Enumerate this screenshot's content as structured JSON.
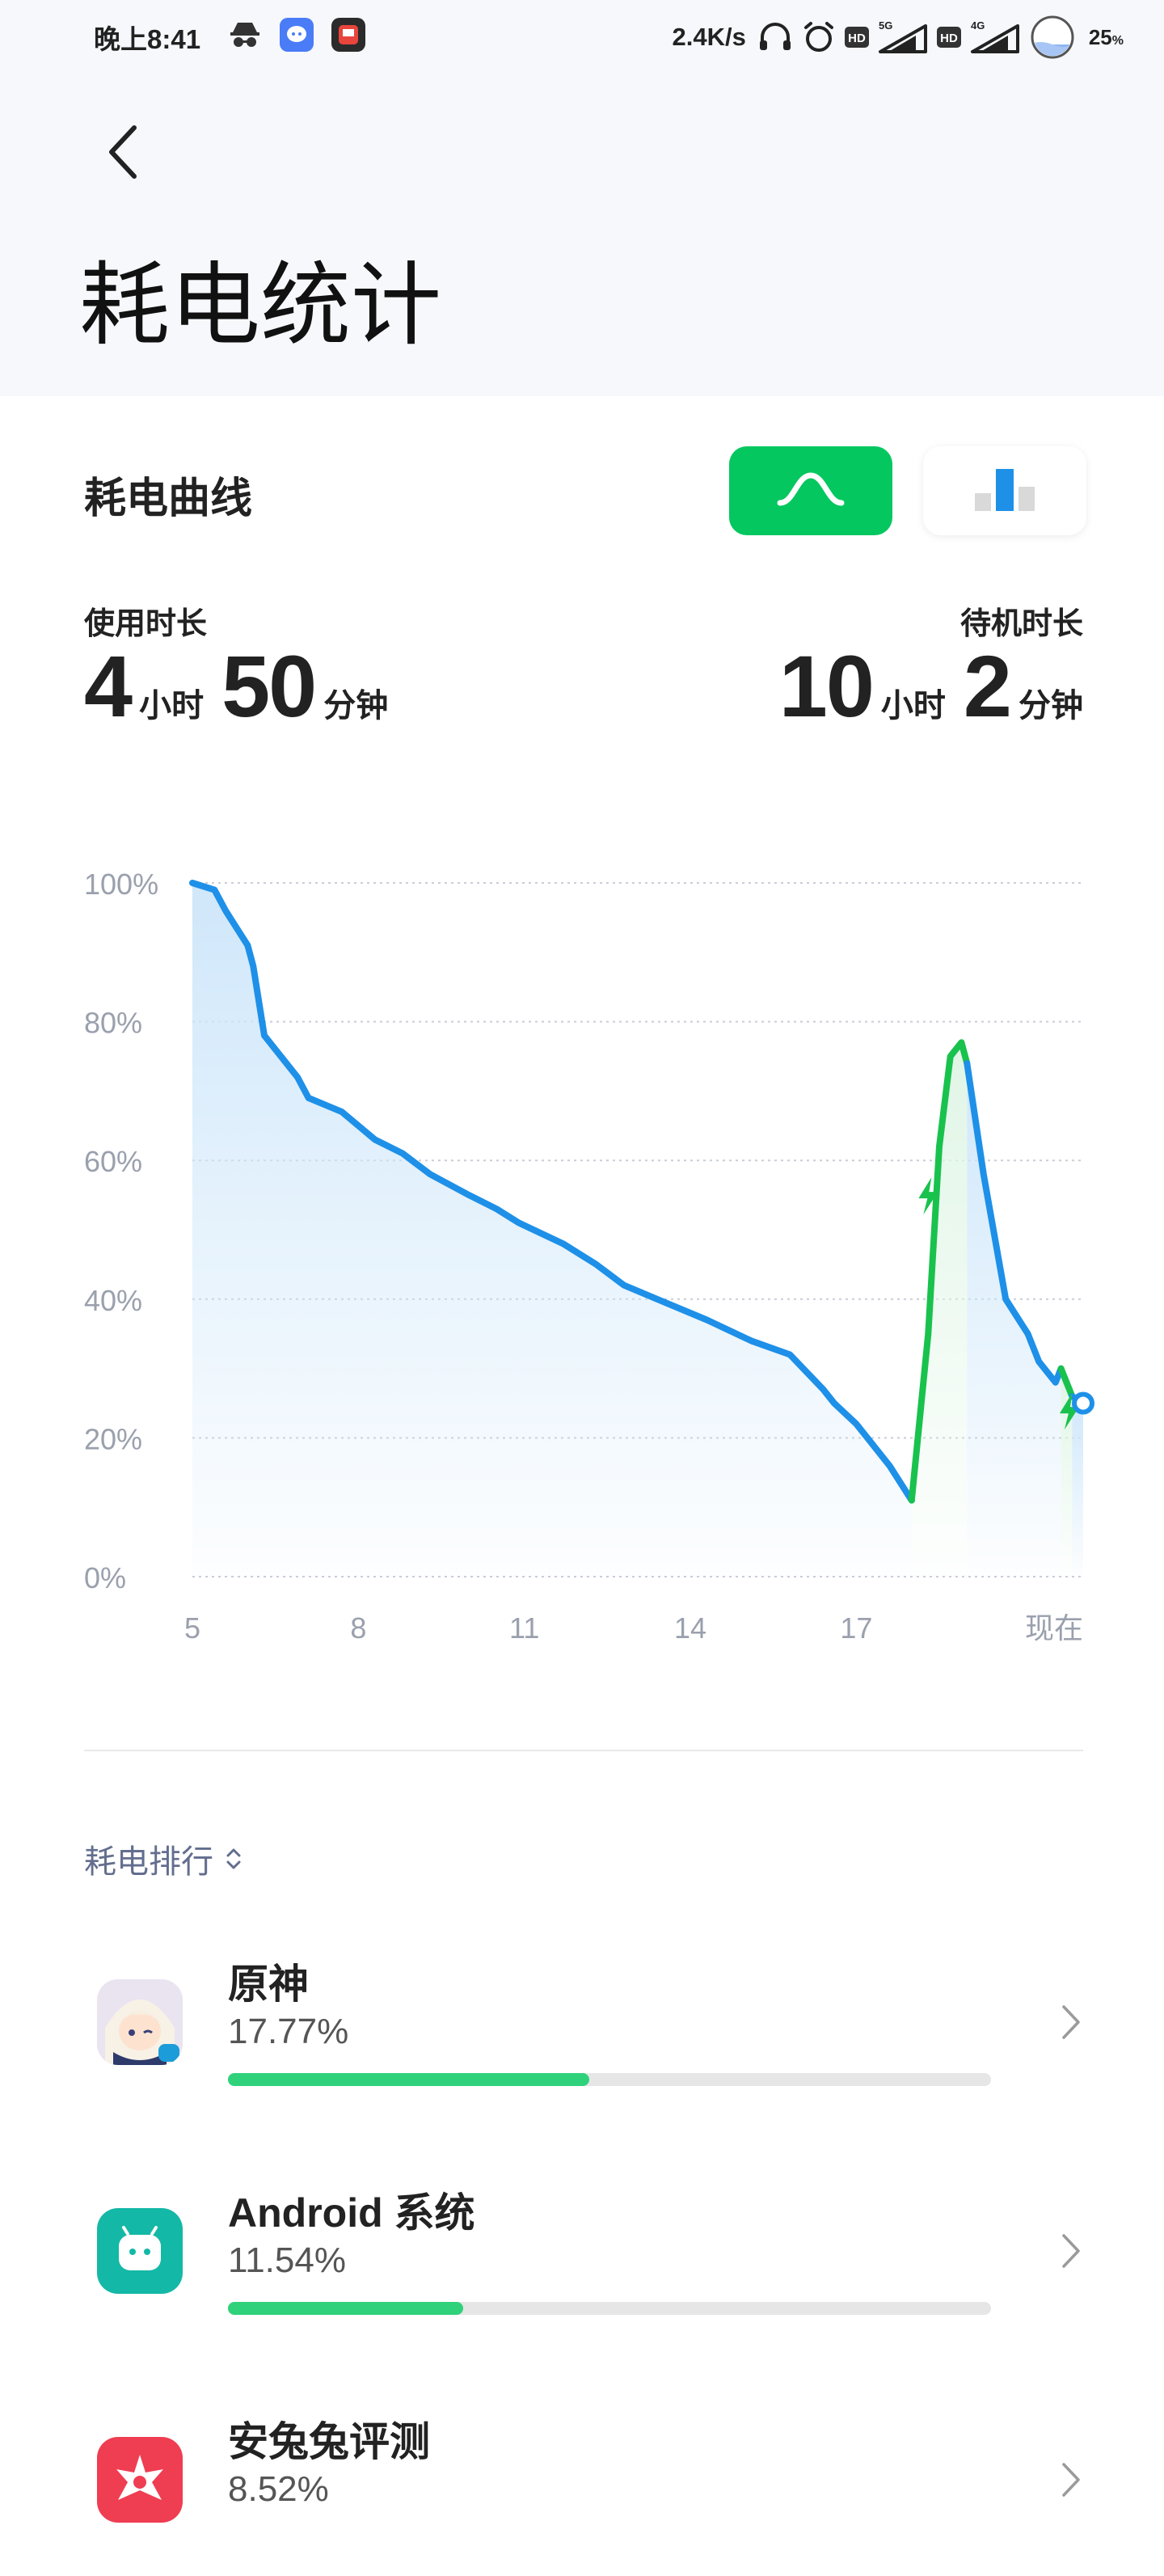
{
  "status_bar": {
    "time": "晚上8:41",
    "net_speed": "2.4K/s",
    "sim1_type": "5G",
    "sim2_type": "4G",
    "hd_label": "HD",
    "battery_level": "25",
    "battery_suffix": "%",
    "icons": [
      "incognito-icon",
      "message-app-icon",
      "music-app-icon",
      "headphones-icon",
      "alarm-icon",
      "hd-icon",
      "signal-icon",
      "battery-icon"
    ]
  },
  "header": {
    "title": "耗电统计"
  },
  "curve_section": {
    "title": "耗电曲线",
    "toggle_curve": "curve-view-icon",
    "toggle_bar": "bar-view-icon",
    "active_view": "curve"
  },
  "usage": {
    "label": "使用时长",
    "hours": "4",
    "hours_unit": "小时",
    "minutes": "50",
    "minutes_unit": "分钟"
  },
  "standby": {
    "label": "待机时长",
    "hours": "10",
    "hours_unit": "小时",
    "minutes": "2",
    "minutes_unit": "分钟"
  },
  "chart_data": {
    "type": "line",
    "y_tick_labels": [
      "100%",
      "80%",
      "60%",
      "40%",
      "20%",
      "0%"
    ],
    "ylim": [
      0,
      100
    ],
    "x_tick_labels": [
      "5",
      "8",
      "11",
      "14",
      "17",
      "现在"
    ],
    "x_tick_values": [
      5,
      8,
      11,
      14,
      17,
      21.1
    ],
    "xlim": [
      5,
      21.1
    ],
    "grid": true,
    "colors": {
      "discharge": "#1e90e8",
      "charge": "#19c24d",
      "fill": "#cde6fa",
      "charge_fill": "#dff5e5",
      "grid": "#c9cdd6"
    },
    "series": [
      {
        "x": [
          5.0,
          5.4,
          5.6,
          6.0,
          6.1,
          6.3,
          6.6,
          6.9,
          7.1,
          7.7,
          8.3,
          8.8,
          9.3,
          10.0,
          10.5,
          10.9,
          11.7,
          12.3,
          12.8,
          13.4,
          14.3,
          15.1,
          15.8,
          16.4,
          16.6,
          17.0,
          17.6,
          18.0
        ],
        "y": [
          100,
          99,
          96,
          91,
          88,
          78,
          75,
          72,
          69,
          67,
          63,
          61,
          58,
          55,
          53,
          51,
          48,
          45,
          42,
          40,
          37,
          34,
          32,
          27,
          25,
          22,
          16,
          11
        ]
      },
      {
        "x": [
          18.0,
          18.3,
          18.5,
          18.7,
          18.9,
          19.0
        ],
        "y": [
          11,
          35,
          62,
          75,
          77,
          74
        ]
      },
      {
        "x": [
          19.0,
          19.3,
          19.7,
          20.1,
          20.3,
          20.6,
          20.7
        ],
        "y": [
          74,
          58,
          40,
          35,
          31,
          28,
          30
        ]
      },
      {
        "x": [
          20.7,
          20.9
        ],
        "y": [
          30,
          26
        ]
      },
      {
        "x": [
          20.9,
          21.1
        ],
        "y": [
          26,
          25
        ]
      }
    ],
    "series_kind": [
      "discharge",
      "charge",
      "discharge",
      "charge",
      "discharge"
    ],
    "charge_markers": [
      {
        "x": 18.3,
        "y": 55
      },
      {
        "x": 20.85,
        "y": 24
      }
    ],
    "current_point": {
      "x": 21.1,
      "y": 25
    }
  },
  "ranking": {
    "sort_label": "耗电排行",
    "sort_icon": "sort-updown-icon",
    "apps": [
      {
        "name": "原神",
        "percent_label": "17.77%",
        "fraction": 0.1777,
        "icon": "genshin-app-icon",
        "icon_color": "#f3e7d8"
      },
      {
        "name": "Android 系统",
        "percent_label": "11.54%",
        "fraction": 0.1154,
        "icon": "android-system-icon",
        "icon_color": "#14b8a6"
      },
      {
        "name": "安兔兔评测",
        "percent_label": "8.52%",
        "fraction": 0.0852,
        "icon": "antutu-app-icon",
        "icon_color": "#ef3d52"
      }
    ]
  }
}
